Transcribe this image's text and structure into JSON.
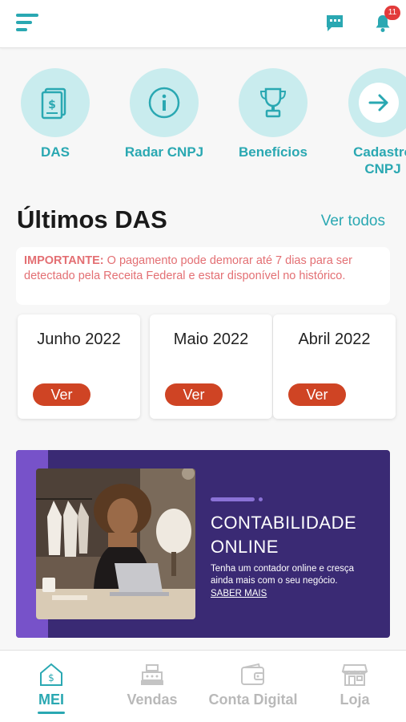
{
  "header": {
    "menu_icon": "hamburger-menu-icon",
    "chat_icon": "chat-bubble-icon",
    "bell_icon": "bell-icon",
    "notification_count": "11",
    "accent_color": "#2aa8b2"
  },
  "quick_actions": [
    {
      "label": "DAS",
      "icon": "document-dollar-icon"
    },
    {
      "label": "Radar CNPJ",
      "icon": "info-icon"
    },
    {
      "label": "Benefícios",
      "icon": "trophy-icon"
    },
    {
      "label": "Cadastro\nCNPJ",
      "icon": "arrow-right-icon"
    }
  ],
  "das_section": {
    "title": "Últimos DAS",
    "see_all": "Ver todos",
    "notice_strong": "IMPORTANTE:",
    "notice_text": " O pagamento pode demorar até 7 dias para ser detectado pela Receita Federal e estar disponível no histórico.",
    "cards": [
      {
        "month": "Junho 2022",
        "button": "Ver"
      },
      {
        "month": "Maio 2022",
        "button": "Ver"
      },
      {
        "month": "Abril 2022",
        "button": "Ver"
      }
    ]
  },
  "banner": {
    "title_line1": "CONTABILIDADE",
    "title_line2": "ONLINE",
    "description": "Tenha um contador online e cresça ainda mais com o seu negócio.",
    "cta": "SABER MAIS",
    "background_color": "#3a2a74"
  },
  "bottom_nav": [
    {
      "label": "MEI",
      "icon": "house-dollar-icon",
      "active": true
    },
    {
      "label": "Vendas",
      "icon": "cash-register-icon",
      "active": false
    },
    {
      "label": "Conta Digital",
      "icon": "wallet-icon",
      "active": false
    },
    {
      "label": "Loja",
      "icon": "store-icon",
      "active": false
    }
  ]
}
